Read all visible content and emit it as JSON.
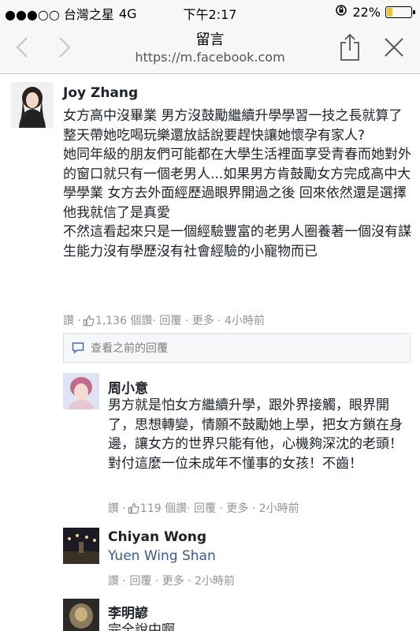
{
  "status_bar": {
    "carrier": "●●●○○ 台灣之星",
    "network": "4G",
    "time": "下午2:17",
    "battery_percent": "22%",
    "battery_level": 0.22
  },
  "nav": {
    "title": "留言",
    "url": "https://m.facebook.com"
  },
  "comments": [
    {
      "author": "Joy Zhang",
      "text": "女方高中沒畢業 男方沒鼓勵繼續升學學習一技之長就算了 整天帶她吃喝玩樂還放話說要趕快讓她懷孕有家人?\n她同年級的朋友們可能都在大學生活裡面享受青春而她對外的窗口就只有一個老男人...如果男方肯鼓勵女方完成高中大學學業 女方去外面經歷過眼界開過之後 回來依然還是選擇他我就信了是真愛\n不然這看起來只是一個經驗豐富的老男人圈養著一個沒有謀生能力沒有學歷沒有社會經驗的小寵物而已",
      "meta_prefix": "讚 · ",
      "likes": "1,136 個讚",
      "meta_suffix": " · 回覆 · 更多 · 4小時前"
    }
  ],
  "previous_replies_label": "查看之前的回覆",
  "replies": [
    {
      "author": "周小意",
      "text": "男方就是怕女方繼續升學，跟外界接觸，眼界開了，思想轉變，情願不鼓勵她上學，把女方鎖在身邊，讓女方的世界只能有他，心機夠深沈的老頭！對付這麼一位未成年不懂事的女孩！不齒！",
      "meta_prefix": "讚 · ",
      "likes": "119 個讚",
      "meta_suffix": " · 回覆 · 更多 · 2小時前"
    },
    {
      "author": "Chiyan Wong",
      "tag": "Yuen Wing Shan",
      "meta": "讚 · 回覆 · 更多 · 2小時前"
    },
    {
      "author": "李明諺",
      "text": "完全說中啊"
    }
  ],
  "colors": {
    "link": "#365899",
    "meta": "#90949c",
    "battery": "#f5c518"
  }
}
